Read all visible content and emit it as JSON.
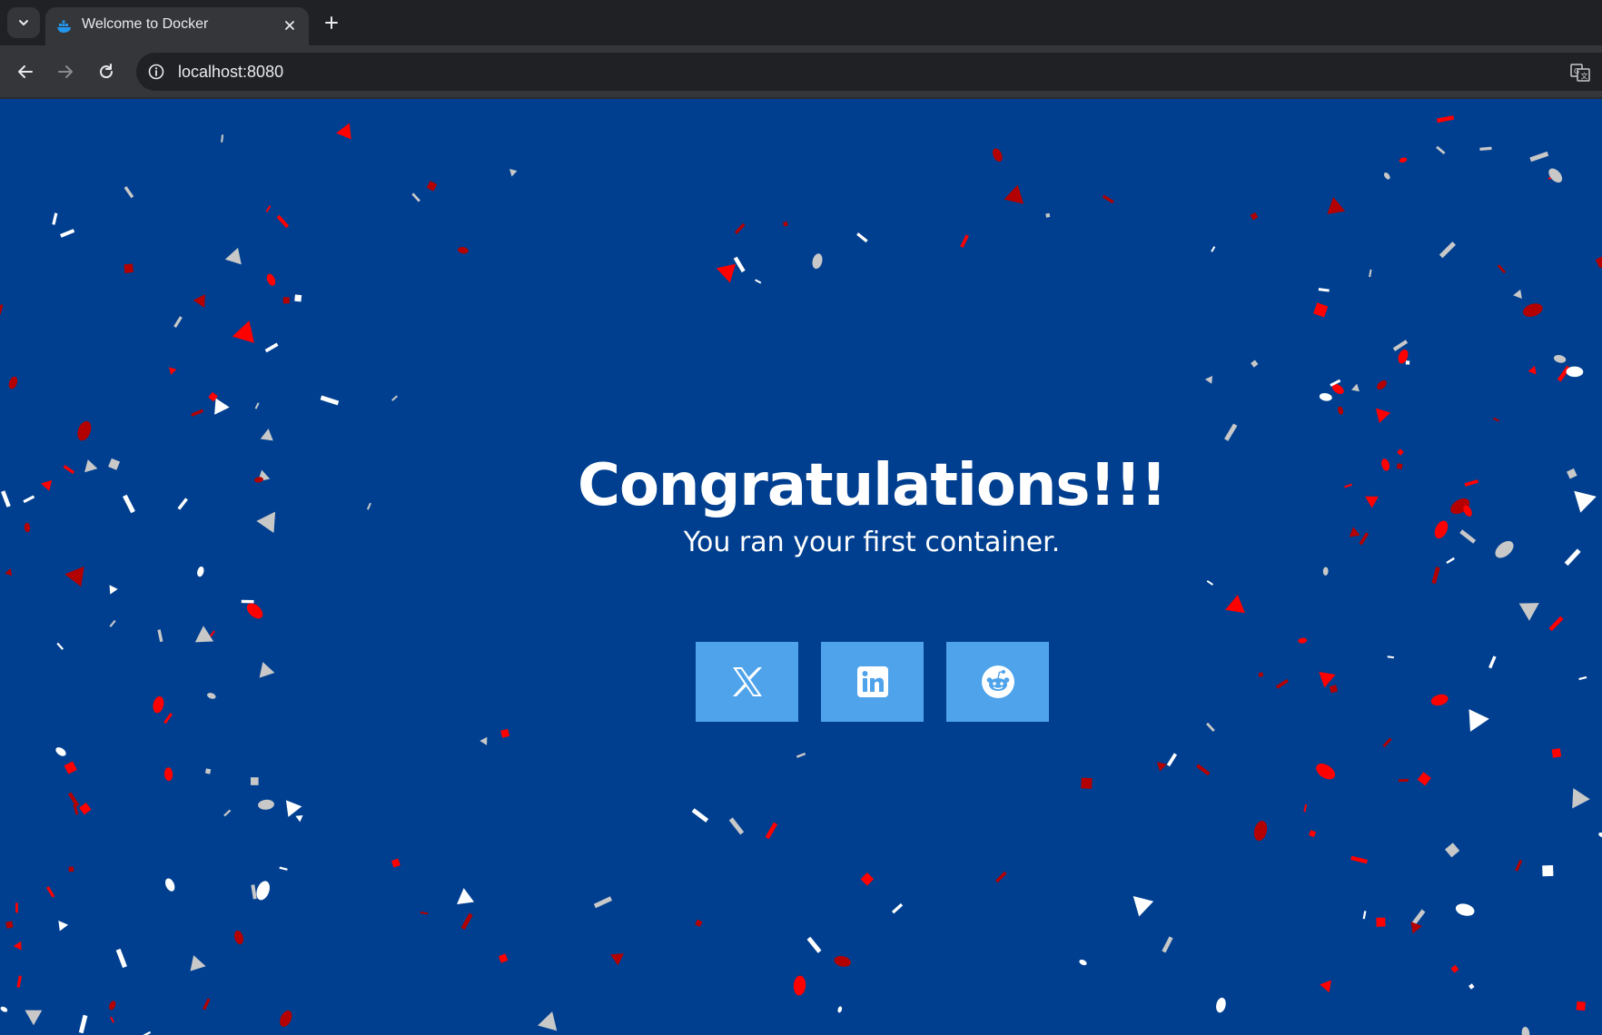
{
  "browser": {
    "tab": {
      "title": "Welcome to Docker",
      "favicon": "docker-whale-icon"
    },
    "address_bar": {
      "url": "localhost:8080"
    },
    "icons": {
      "tab_menu": "chevron-down-icon",
      "close_tab": "close-icon",
      "new_tab": "plus-icon",
      "back": "arrow-left-icon",
      "forward": "arrow-right-icon",
      "reload": "reload-icon",
      "site_info": "info-icon",
      "translate": "translate-icon"
    }
  },
  "page": {
    "title": "Congratulations!!!",
    "subtitle": "You ran your first container.",
    "share_buttons": [
      {
        "icon": "x-twitter-icon"
      },
      {
        "icon": "linkedin-icon"
      },
      {
        "icon": "reddit-icon"
      }
    ],
    "decoration": "confetti"
  },
  "colors": {
    "page_background": "#003f8f",
    "share_button": "#4ea3ea",
    "confetti_red": "#ff0000",
    "confetti_dark_red": "#b30000",
    "confetti_white": "#ffffff",
    "confetti_gray": "#c8c8c8",
    "chrome_dark": "#202124",
    "chrome_toolbar": "#35363a"
  }
}
